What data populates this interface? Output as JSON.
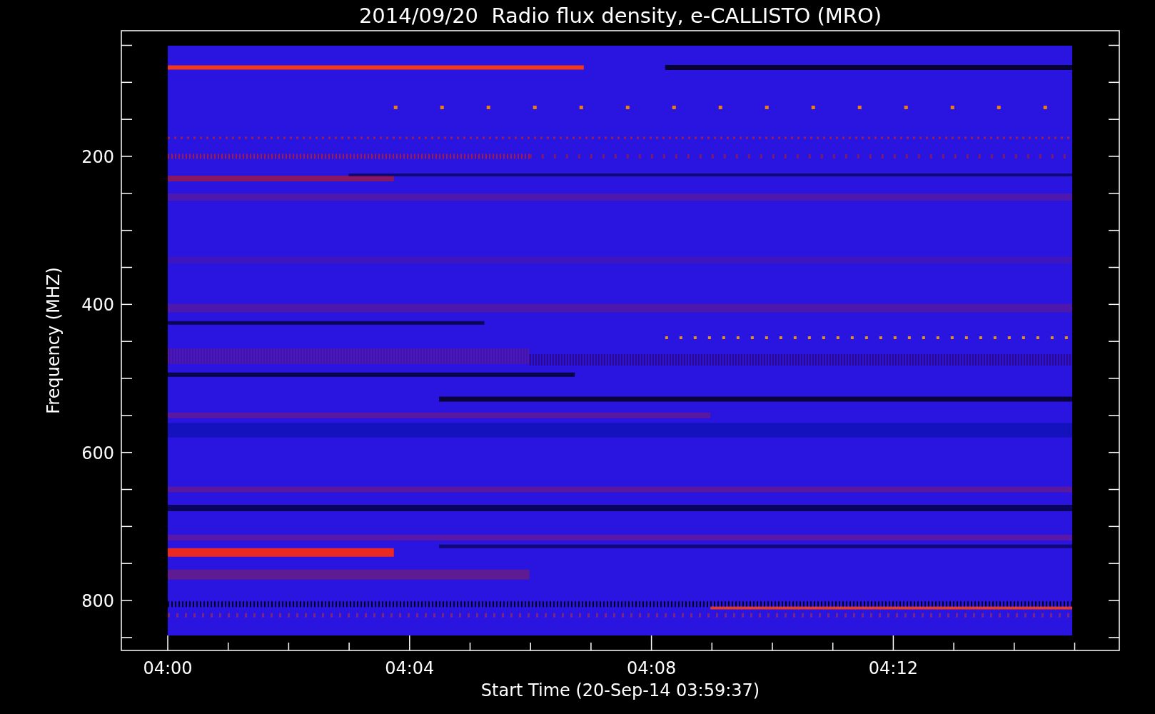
{
  "title": "2014/09/20  Radio flux density, e-CALLISTO (MRO)",
  "y_axis": {
    "label": "Frequency (MHZ)",
    "ticks": [
      "200",
      "400",
      "600",
      "800"
    ]
  },
  "x_axis": {
    "label": "Start Time (20-Sep-14 03:59:37)",
    "ticks": [
      "04:00",
      "04:04",
      "04:08",
      "04:12"
    ]
  }
}
